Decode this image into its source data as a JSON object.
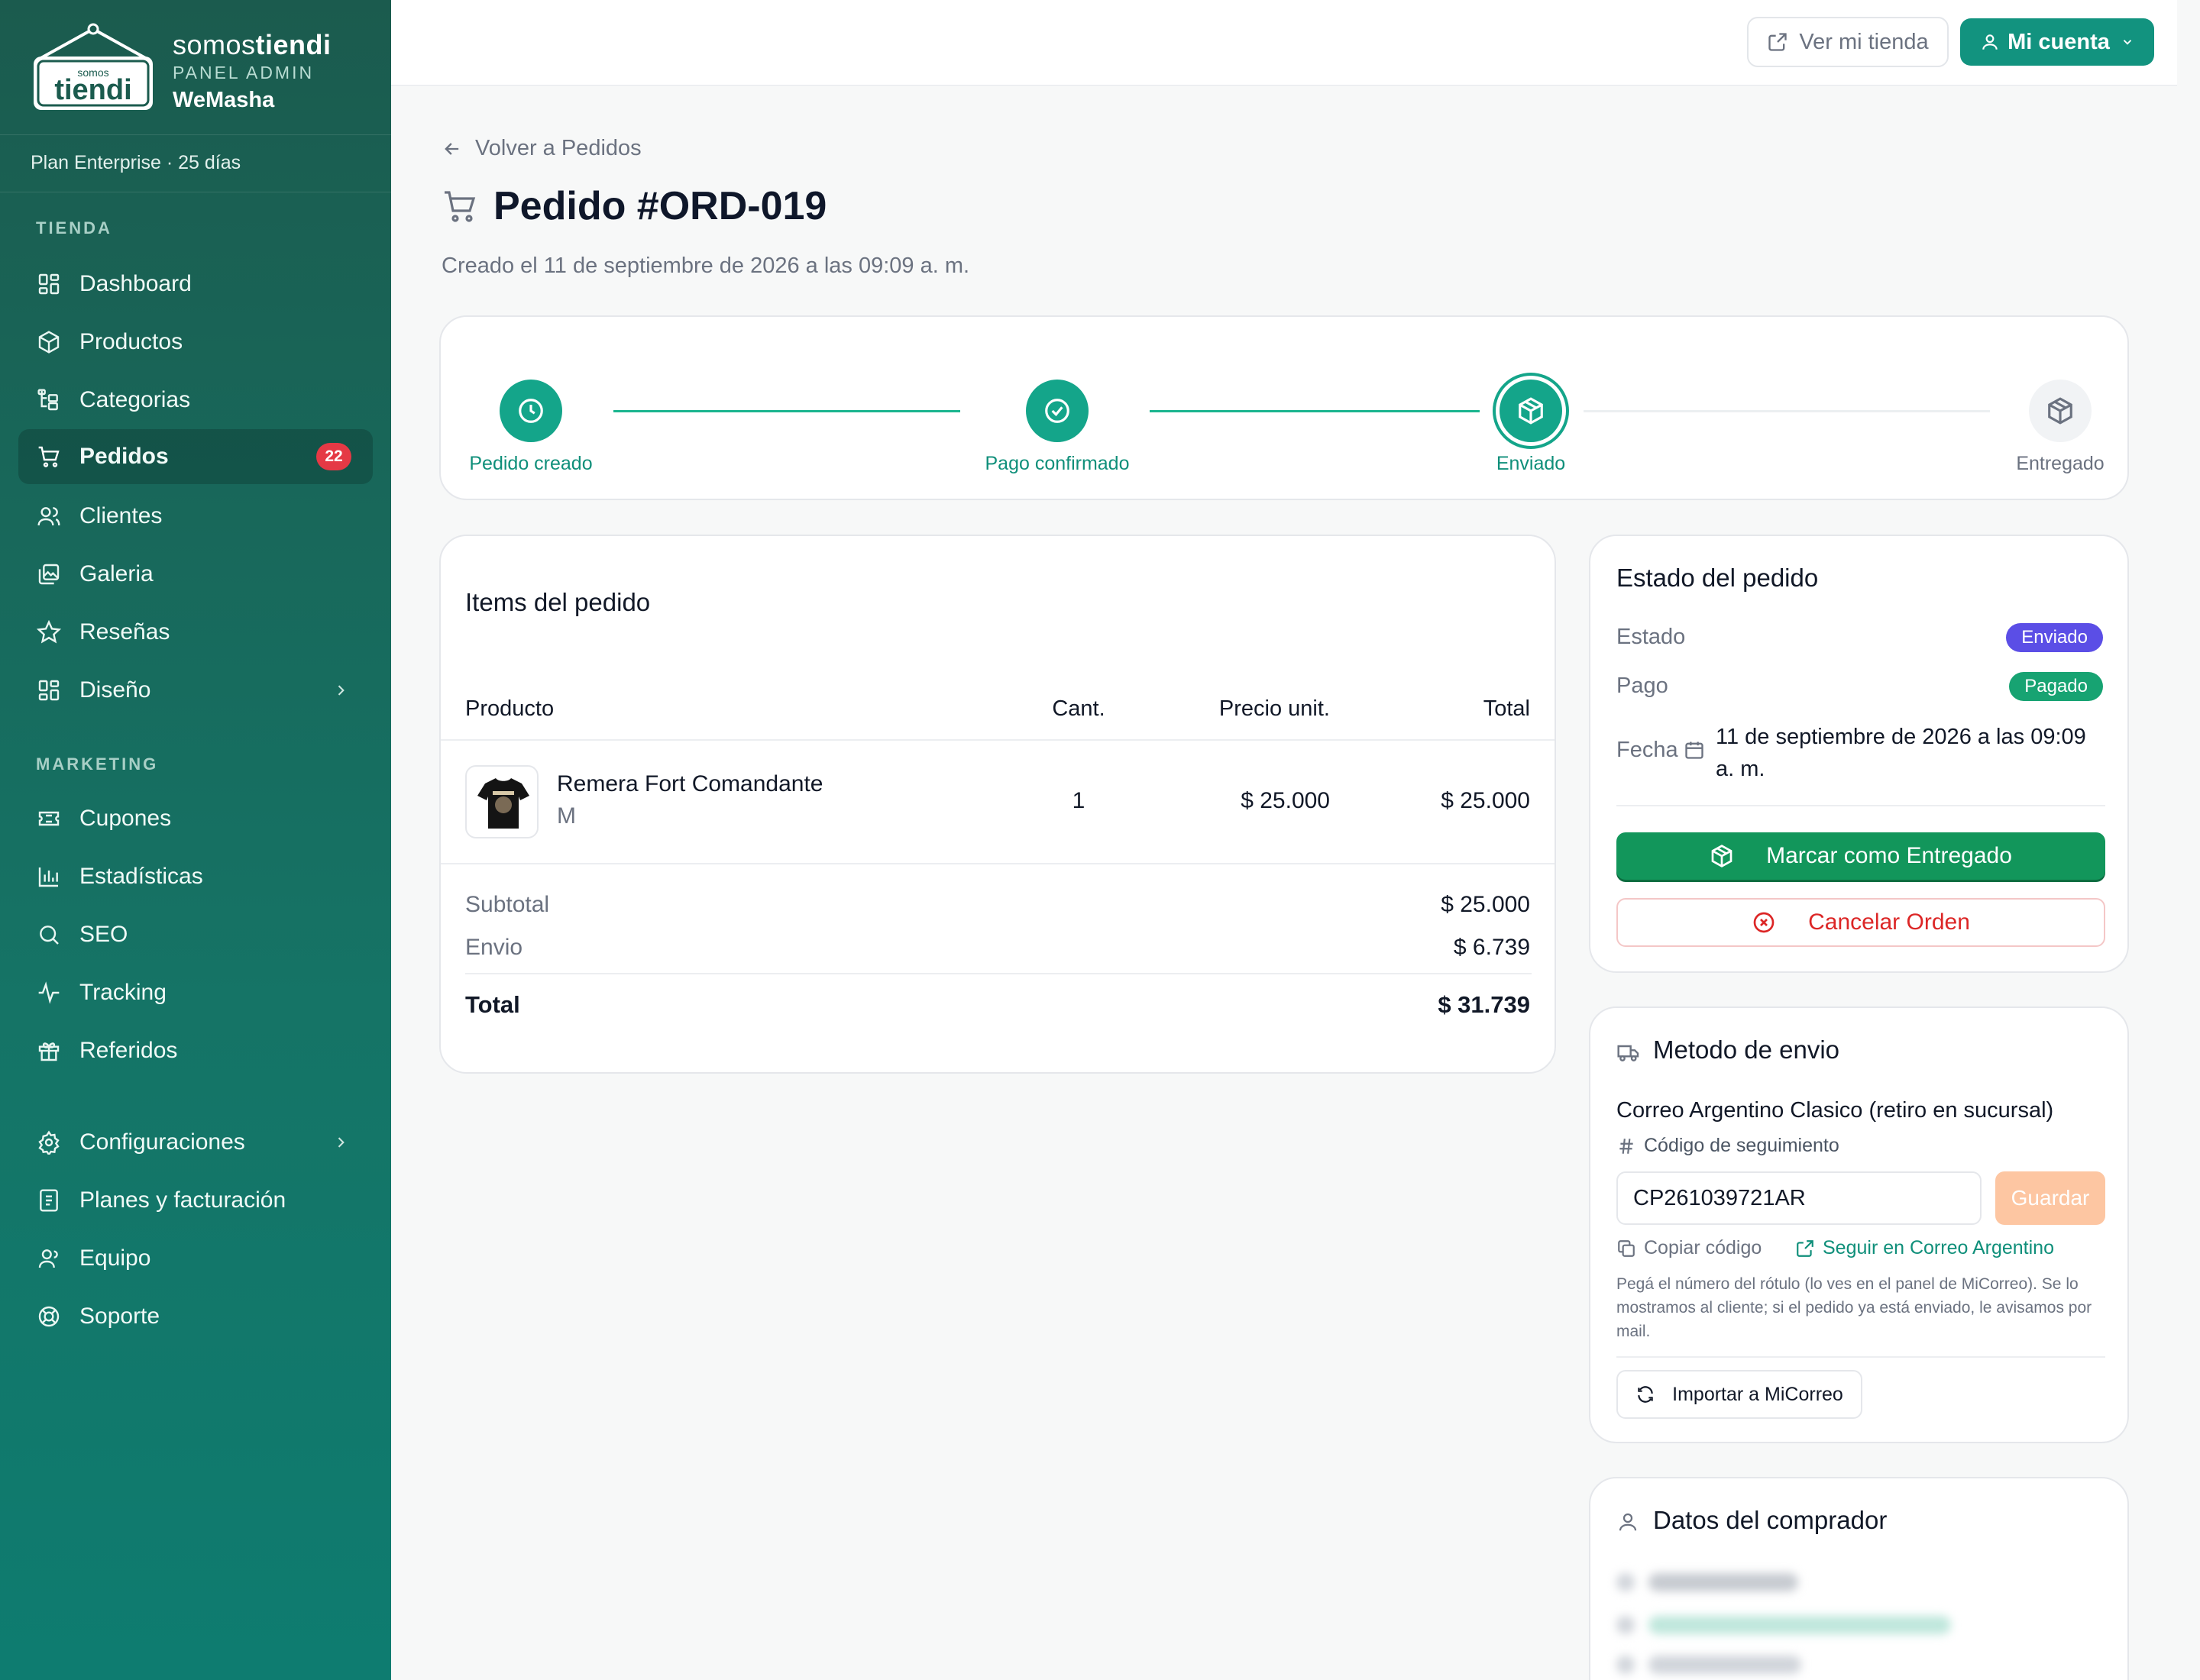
{
  "brand": {
    "name_light": "somos",
    "name_bold": "tiendi",
    "subtitle": "PANEL ADMIN",
    "store": "WeMasha",
    "logo_small": "somos",
    "logo_big": "tiendi"
  },
  "plan": "Plan Enterprise · 25 días",
  "sidebar": {
    "section_store": "TIENDA",
    "section_marketing": "MARKETING",
    "items": [
      {
        "label": "Dashboard",
        "icon": "dashboard-icon"
      },
      {
        "label": "Productos",
        "icon": "box-icon"
      },
      {
        "label": "Categorias",
        "icon": "tree-icon"
      },
      {
        "label": "Pedidos",
        "icon": "cart-icon",
        "badge": "22"
      },
      {
        "label": "Clientes",
        "icon": "users-icon"
      },
      {
        "label": "Galeria",
        "icon": "images-icon"
      },
      {
        "label": "Reseñas",
        "icon": "star-icon"
      },
      {
        "label": "Diseño",
        "icon": "layout-icon"
      },
      {
        "label": "Cupones",
        "icon": "ticket-icon"
      },
      {
        "label": "Estadísticas",
        "icon": "bar-chart-icon"
      },
      {
        "label": "SEO",
        "icon": "search-icon"
      },
      {
        "label": "Tracking",
        "icon": "activity-icon"
      },
      {
        "label": "Referidos",
        "icon": "gift-icon"
      },
      {
        "label": "Configuraciones",
        "icon": "gear-icon"
      },
      {
        "label": "Planes y facturación",
        "icon": "receipt-icon"
      },
      {
        "label": "Equipo",
        "icon": "team-icon"
      },
      {
        "label": "Soporte",
        "icon": "lifebuoy-icon"
      }
    ]
  },
  "topbar": {
    "view_store": "Ver mi tienda",
    "account": "Mi cuenta"
  },
  "header": {
    "back": "Volver a Pedidos",
    "title": "Pedido #ORD-019",
    "created": "Creado el 11 de septiembre de 2026 a las 09:09 a. m."
  },
  "progress": {
    "steps": [
      {
        "label": "Pedido creado",
        "state": "done"
      },
      {
        "label": "Pago confirmado",
        "state": "done"
      },
      {
        "label": "Enviado",
        "state": "current"
      },
      {
        "label": "Entregado",
        "state": "pending"
      }
    ]
  },
  "items": {
    "title": "Items del pedido",
    "columns": [
      "Producto",
      "Cant.",
      "Precio unit.",
      "Total"
    ],
    "rows": [
      {
        "name": "Remera Fort Comandante",
        "variant": "M",
        "qty": "1",
        "unit_price": "$ 25.000",
        "total": "$ 25.000"
      }
    ],
    "subtotal_label": "Subtotal",
    "subtotal": "$ 25.000",
    "shipping_label": "Envio",
    "shipping": "$ 6.739",
    "total_label": "Total",
    "total": "$ 31.739"
  },
  "status": {
    "title": "Estado del pedido",
    "state_label": "Estado",
    "state_value": "Enviado",
    "payment_label": "Pago",
    "payment_value": "Pagado",
    "date_label": "Fecha",
    "date_value": "11 de septiembre de 2026 a las 09:09 a. m.",
    "mark_delivered": "Marcar como Entregado",
    "cancel": "Cancelar Orden",
    "colors": {
      "enviado": "#5b4ee6",
      "pagado": "#17a372"
    }
  },
  "shipping": {
    "title": "Metodo de envio",
    "method": "Correo Argentino Clasico (retiro en sucursal)",
    "tracking_label": "Código de seguimiento",
    "tracking_code": "CP261039721AR",
    "save": "Guardar",
    "copy": "Copiar código",
    "follow": "Seguir en Correo Argentino",
    "help": "Pegá el número del rótulo (lo ves en el panel de MiCorreo). Se lo mostramos al cliente; si el pedido ya está enviado, le avisamos por mail.",
    "import": "Importar a MiCorreo"
  },
  "buyer": {
    "title": "Datos del comprador"
  }
}
